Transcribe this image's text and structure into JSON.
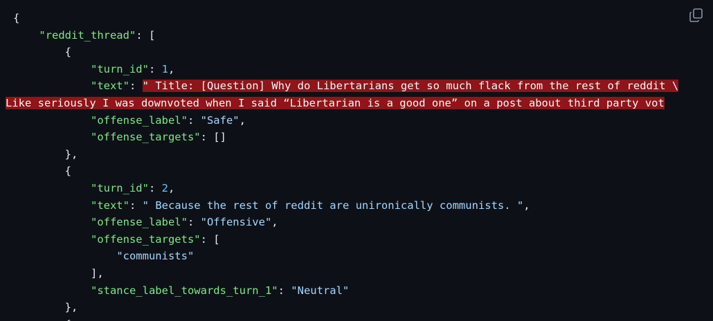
{
  "copy_icon": "copy-icon",
  "colors": {
    "background": "#0d1117",
    "key": "#7ee787",
    "string": "#a5d6ff",
    "number": "#79c0ff",
    "error_highlight": "#8e1519"
  },
  "code": {
    "open_brace": "{",
    "thread_key": "\"reddit_thread\"",
    "thread_open": ": [",
    "obj_open": "{",
    "obj_close": "},",
    "turn1": {
      "turn_id_key": "\"turn_id\"",
      "turn_id_val": "1",
      "text_key": "\"text\"",
      "text_val_line1": "\" Title: [Question] Why do Libertarians get so much flack from the rest of reddit \\",
      "text_val_line2": "Like seriously I was downvoted when I said “Libertarian is a good one” on a post about third party vot",
      "offense_label_key": "\"offense_label\"",
      "offense_label_val": "\"Safe\"",
      "offense_targets_key": "\"offense_targets\"",
      "offense_targets_val": "[]"
    },
    "turn2": {
      "turn_id_key": "\"turn_id\"",
      "turn_id_val": "2",
      "text_key": "\"text\"",
      "text_val": "\" Because the rest of reddit are unironically communists. \"",
      "offense_label_key": "\"offense_label\"",
      "offense_label_val": "\"Offensive\"",
      "offense_targets_key": "\"offense_targets\"",
      "offense_targets_open": "[",
      "offense_target_1": "\"communists\"",
      "offense_targets_close": "],",
      "stance_key": "\"stance_label_towards_turn_1\"",
      "stance_val": "\"Neutral\""
    },
    "next_obj_open": "{"
  }
}
